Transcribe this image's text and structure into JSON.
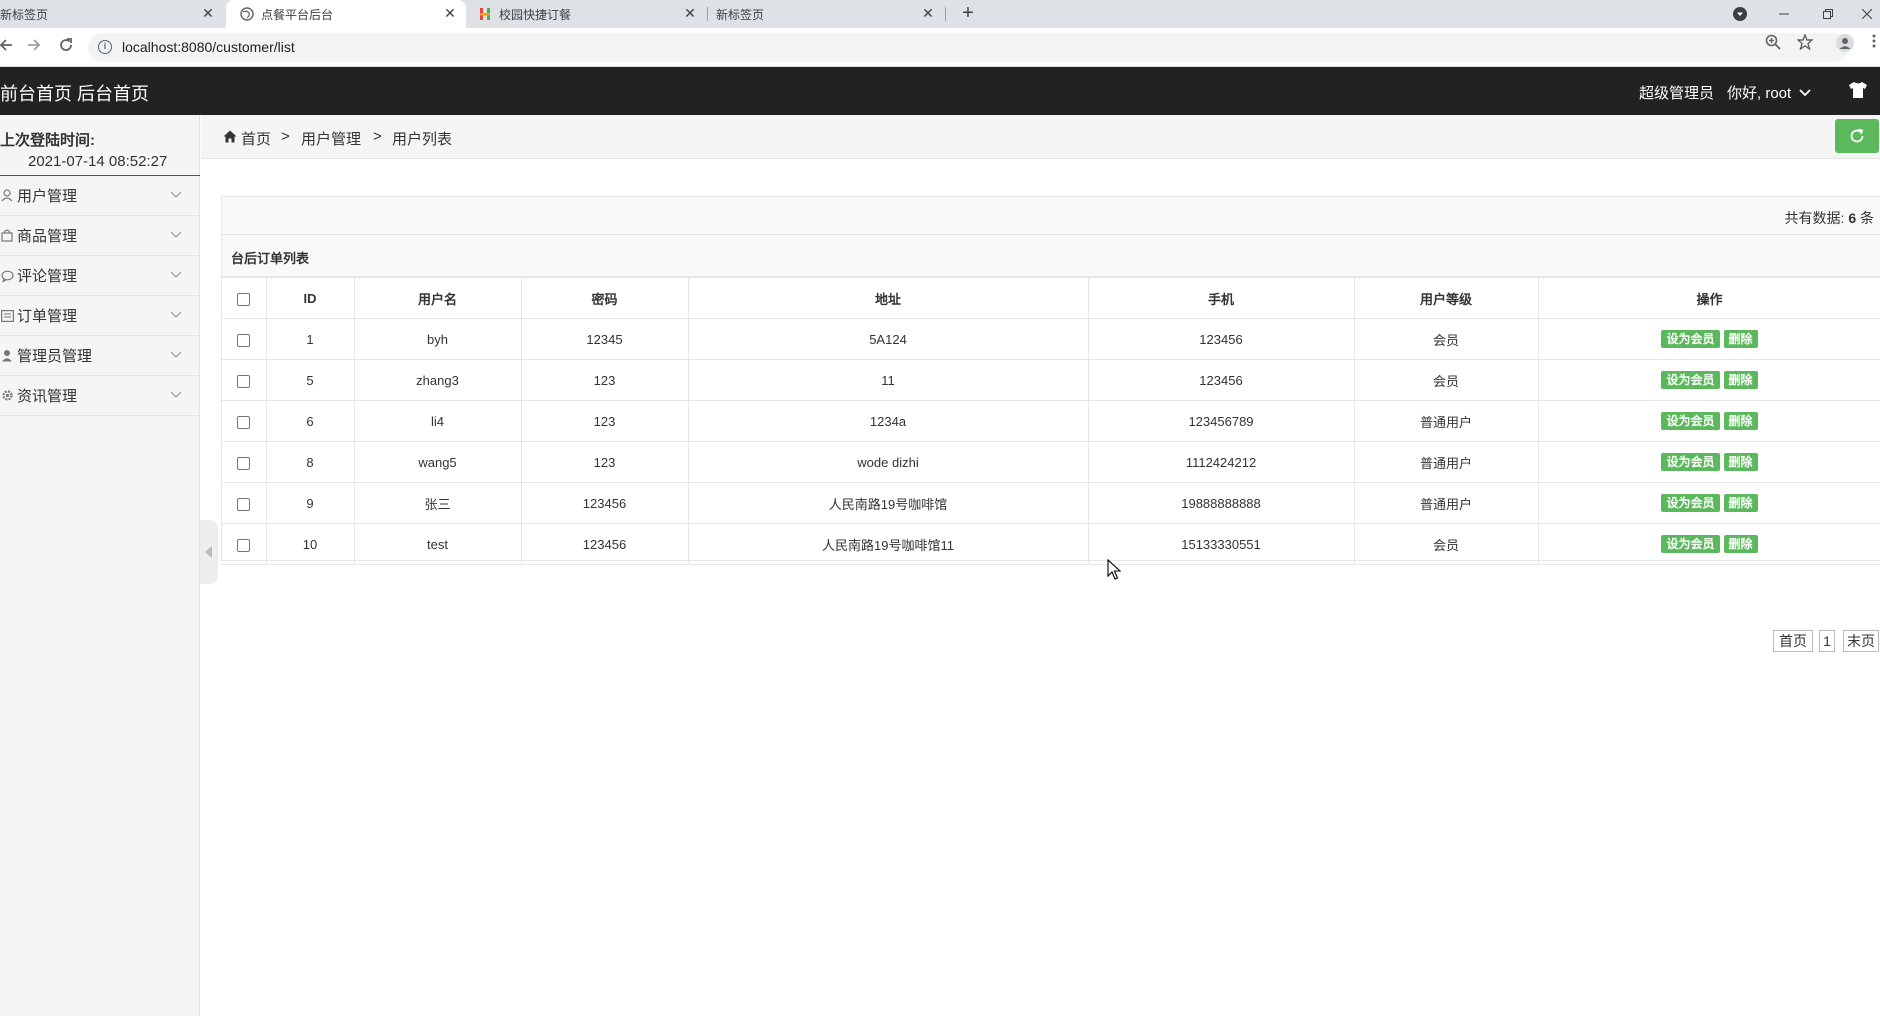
{
  "browser": {
    "tabs": [
      {
        "title": "新标签页",
        "active": false
      },
      {
        "title": "点餐平台后台",
        "active": true
      },
      {
        "title": "校园快捷订餐",
        "active": false
      },
      {
        "title": "新标签页",
        "active": false
      }
    ],
    "url": "localhost:8080/customer/list"
  },
  "header": {
    "front_link": "前台首页",
    "back_link": "后台首页",
    "role": "超级管理员",
    "greeting": "你好, root"
  },
  "sidebar": {
    "last_login_label": "上次登陆时间:",
    "last_login_time": "2021-07-14 08:52:27",
    "items": [
      {
        "label": "用户管理",
        "icon": "user-icon"
      },
      {
        "label": "商品管理",
        "icon": "bag-icon"
      },
      {
        "label": "评论管理",
        "icon": "comment-icon"
      },
      {
        "label": "订单管理",
        "icon": "list-icon"
      },
      {
        "label": "管理员管理",
        "icon": "admin-icon"
      },
      {
        "label": "资讯管理",
        "icon": "gear-icon"
      }
    ]
  },
  "breadcrumb": {
    "items": [
      "首页",
      "用户管理",
      "用户列表"
    ],
    "separator": ">"
  },
  "panel": {
    "total_prefix": "共有数据:",
    "total_count": "6",
    "total_suffix": "条",
    "title": "台后订单列表"
  },
  "table": {
    "headers": [
      "ID",
      "用户名",
      "密码",
      "地址",
      "手机",
      "用户等级",
      "操作"
    ],
    "action_labels": {
      "set_member": "设为会员",
      "delete": "删除"
    },
    "rows": [
      {
        "id": "1",
        "username": "byh",
        "password": "12345",
        "address": "5A124",
        "phone": "123456",
        "level": "会员"
      },
      {
        "id": "5",
        "username": "zhang3",
        "password": "123",
        "address": "11",
        "phone": "123456",
        "level": "会员"
      },
      {
        "id": "6",
        "username": "li4",
        "password": "123",
        "address": "1234a",
        "phone": "123456789",
        "level": "普通用户"
      },
      {
        "id": "8",
        "username": "wang5",
        "password": "123",
        "address": "wode dizhi",
        "phone": "1112424212",
        "level": "普通用户"
      },
      {
        "id": "9",
        "username": "张三",
        "password": "123456",
        "address": "人民南路19号咖啡馆",
        "phone": "19888888888",
        "level": "普通用户"
      },
      {
        "id": "10",
        "username": "test",
        "password": "123456",
        "address": "人民南路19号咖啡馆11",
        "phone": "15133330551",
        "level": "会员"
      }
    ]
  },
  "pagination": {
    "first": "首页",
    "current": "1",
    "last": "末页"
  },
  "colors": {
    "header_bg": "#222222",
    "accent_green": "#5cb85c",
    "sidebar_bg": "#f5f5f5"
  }
}
